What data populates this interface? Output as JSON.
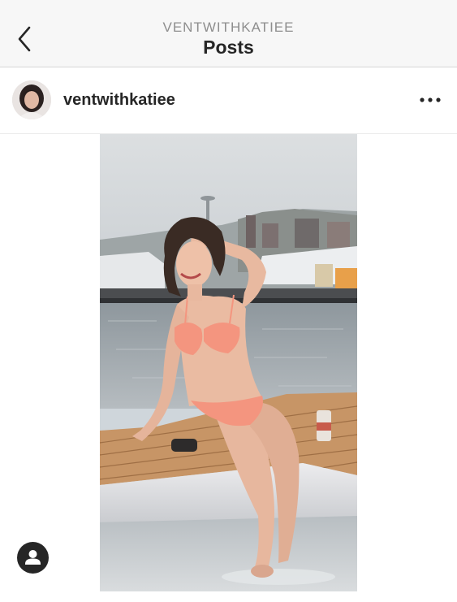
{
  "nav": {
    "subtitle": "VENTWITHKATIEE",
    "title": "Posts"
  },
  "post": {
    "username": "ventwithkatiee"
  },
  "icons": {
    "back": "chevron-left-icon",
    "more": "more-horizontal-icon",
    "tag": "user-tag-icon"
  },
  "colors": {
    "bikini": "#f4957f",
    "water": "#9aa3a9",
    "deck": "#c79566",
    "hull": "#e5e5e7"
  }
}
